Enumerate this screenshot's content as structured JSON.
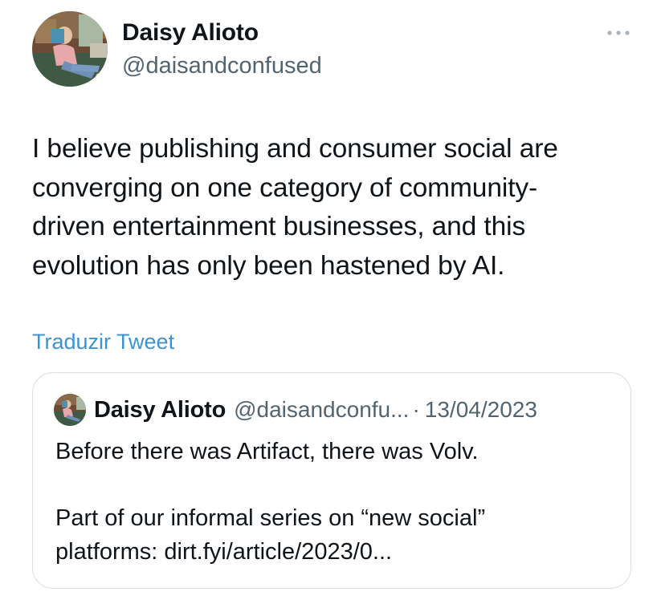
{
  "author": {
    "display_name": "Daisy Alioto",
    "handle": "@daisandconfused",
    "avatar_icon": "profile-photo"
  },
  "more_icon": "more-horizontal-icon",
  "tweet": {
    "text": "I believe publishing and consumer social are\nconverging on one category of community-\ndriven entertainment businesses, and this\nevolution has only been hastened by AI."
  },
  "translate_label": "Traduzir Tweet",
  "quoted_tweet": {
    "display_name": "Daisy Alioto",
    "handle": "@daisandconfu...",
    "separator": "·",
    "date": "13/04/2023",
    "text": "Before there was Artifact, there was Volv.\n\nPart of our informal series on “new social”\nplatforms: dirt.fyi/article/2023/0..."
  },
  "colors": {
    "text": "#0f1419",
    "secondary": "#536471",
    "link": "#3a94d2",
    "border": "#d9dfe3"
  }
}
